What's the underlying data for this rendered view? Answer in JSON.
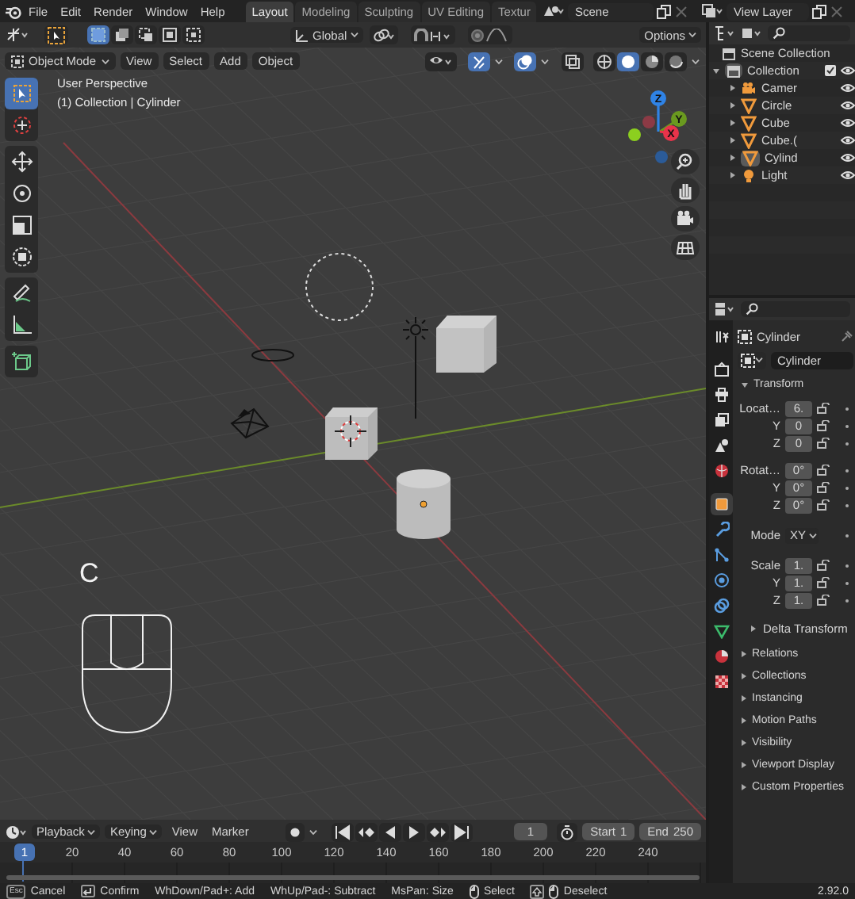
{
  "top_bar": {
    "menus": [
      "File",
      "Edit",
      "Render",
      "Window",
      "Help"
    ],
    "workspaces": [
      {
        "label": "Layout",
        "selected": true
      },
      {
        "label": "Modeling",
        "selected": false
      },
      {
        "label": "Sculpting",
        "selected": false
      },
      {
        "label": "UV Editing",
        "selected": false
      },
      {
        "label": "Textur",
        "selected": false
      }
    ],
    "scene": "Scene",
    "view_layer": "View Layer"
  },
  "tool_header": {
    "orientation": "Global",
    "options": "Options"
  },
  "viewport_header": {
    "mode": "Object Mode",
    "menus": [
      "View",
      "Select",
      "Add",
      "Object"
    ]
  },
  "viewport": {
    "title": "User Perspective",
    "subtitle": "(1) Collection | Cylinder",
    "key_overlay": "C",
    "toolbar": [
      [
        {
          "kind": "select",
          "selected": true
        },
        {
          "kind": "cursor",
          "selected": false
        }
      ],
      [
        {
          "kind": "move",
          "selected": false
        },
        {
          "kind": "rotate",
          "selected": false
        },
        {
          "kind": "scale",
          "selected": false
        },
        {
          "kind": "transform",
          "selected": false
        }
      ],
      [
        {
          "kind": "annotate",
          "selected": false
        },
        {
          "kind": "measure",
          "selected": false
        }
      ],
      [
        {
          "kind": "add-cube",
          "selected": false
        }
      ]
    ],
    "gizmo": [
      {
        "label": "Z",
        "color": "#2f83e6"
      },
      {
        "label": "Y",
        "color": "#6a9a1f"
      },
      {
        "label": "X",
        "color": "#e8334a"
      }
    ]
  },
  "outliner": {
    "root": "Scene Collection",
    "items": [
      {
        "label": "Collection",
        "expanded": true,
        "checked": true,
        "children": [
          {
            "label": "Camer",
            "kind": "camera",
            "selected": false
          },
          {
            "label": "Circle",
            "kind": "mesh",
            "selected": false
          },
          {
            "label": "Cube",
            "kind": "mesh",
            "selected": false
          },
          {
            "label": "Cube.(",
            "kind": "mesh",
            "selected": false
          },
          {
            "label": "Cylind",
            "kind": "mesh",
            "selected": true
          },
          {
            "label": "Light",
            "kind": "light",
            "selected": false
          }
        ]
      }
    ]
  },
  "properties": {
    "tabs": [
      {
        "kind": "tool",
        "selected": false
      },
      {
        "kind": "render",
        "selected": false
      },
      {
        "kind": "output",
        "selected": false
      },
      {
        "kind": "view-layer",
        "selected": false
      },
      {
        "kind": "scene",
        "selected": false
      },
      {
        "kind": "world",
        "selected": false
      },
      {
        "kind": "object",
        "selected": true
      },
      {
        "kind": "modifier",
        "selected": false
      },
      {
        "kind": "particles",
        "selected": false
      },
      {
        "kind": "physics",
        "selected": false
      },
      {
        "kind": "constraints",
        "selected": false
      },
      {
        "kind": "data",
        "selected": false
      },
      {
        "kind": "material",
        "selected": false
      },
      {
        "kind": "texture",
        "selected": false
      }
    ],
    "object_name": "Cylinder",
    "data_name": "Cylinder",
    "transform": {
      "title": "Transform",
      "expanded": true,
      "groups": [
        {
          "rows": [
            {
              "kind": "field",
              "label": "Locat…",
              "value": "6."
            },
            {
              "kind": "field",
              "label": "Y",
              "value": "0"
            },
            {
              "kind": "field",
              "label": "Z",
              "value": "0"
            }
          ]
        },
        {
          "rows": [
            {
              "kind": "field",
              "label": "Rotat…",
              "value": "0°"
            },
            {
              "kind": "field",
              "label": "Y",
              "value": "0°"
            },
            {
              "kind": "field",
              "label": "Z",
              "value": "0°"
            }
          ]
        },
        {
          "rows": [
            {
              "kind": "dropdown",
              "label": "Mode",
              "value": "XY"
            }
          ]
        },
        {
          "rows": [
            {
              "kind": "field",
              "label": "Scale",
              "value": "1."
            },
            {
              "kind": "field",
              "label": "Y",
              "value": "1."
            },
            {
              "kind": "field",
              "label": "Z",
              "value": "1."
            }
          ]
        }
      ],
      "subpanel": {
        "title": "Delta Transform",
        "expanded": false
      }
    },
    "panels": [
      {
        "title": "Relations",
        "expanded": false
      },
      {
        "title": "Collections",
        "expanded": false
      },
      {
        "title": "Instancing",
        "expanded": false
      },
      {
        "title": "Motion Paths",
        "expanded": false
      },
      {
        "title": "Visibility",
        "expanded": false
      },
      {
        "title": "Viewport Display",
        "expanded": false
      },
      {
        "title": "Custom Properties",
        "expanded": false
      }
    ]
  },
  "timeline": {
    "menus": [
      {
        "label": "Playback",
        "dropdown": true
      },
      {
        "label": "Keying",
        "dropdown": true
      },
      {
        "label": "View",
        "dropdown": false
      },
      {
        "label": "Marker",
        "dropdown": false
      }
    ],
    "current_frame": "1",
    "start_label": "Start",
    "start": "1",
    "end_label": "End",
    "end": "250",
    "ruler_current": "1",
    "ruler_ticks": [
      "20",
      "40",
      "60",
      "80",
      "100",
      "120",
      "140",
      "160",
      "180",
      "200",
      "220",
      "240"
    ]
  },
  "status_bar": {
    "items": [
      {
        "kind": "esc",
        "key": "Esc",
        "label": "Cancel"
      },
      {
        "kind": "enter",
        "label": "Confirm"
      },
      {
        "kind": "text",
        "label": "WhDown/Pad+: Add"
      },
      {
        "kind": "text",
        "label": "WhUp/Pad-: Subtract"
      },
      {
        "kind": "text",
        "label": "MsPan: Size"
      },
      {
        "kind": "mouse",
        "label": "Select"
      },
      {
        "kind": "shift-mouse",
        "label": "Deselect"
      }
    ],
    "version": "2.92.0"
  }
}
